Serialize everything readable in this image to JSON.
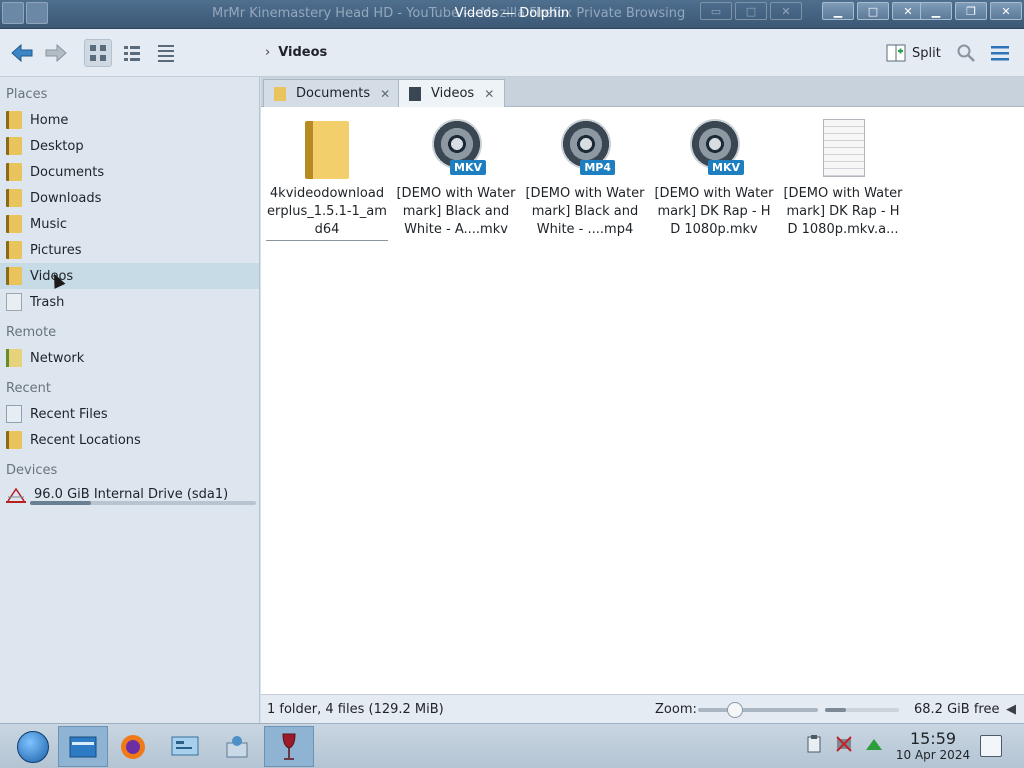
{
  "window": {
    "title": "Videos — Dolphin",
    "background_window_title": "MrMr Kinemastery Head HD - YouTube — Mozilla Firefox Private Browsing"
  },
  "toolbar": {
    "breadcrumb_current": "Videos",
    "split_label": "Split"
  },
  "sidebar": {
    "sections": {
      "places": "Places",
      "remote": "Remote",
      "recent": "Recent",
      "devices": "Devices"
    },
    "places": [
      {
        "label": "Home"
      },
      {
        "label": "Desktop"
      },
      {
        "label": "Documents"
      },
      {
        "label": "Downloads"
      },
      {
        "label": "Music"
      },
      {
        "label": "Pictures"
      },
      {
        "label": "Videos",
        "selected": true
      },
      {
        "label": "Trash"
      }
    ],
    "remote": [
      {
        "label": "Network"
      }
    ],
    "recent": [
      {
        "label": "Recent Files"
      },
      {
        "label": "Recent Locations"
      }
    ],
    "devices": [
      {
        "label": "96.0 GiB Internal Drive (sda1)",
        "usage_fraction": 0.27
      }
    ]
  },
  "tabs": [
    {
      "label": "Documents",
      "active": false
    },
    {
      "label": "Videos",
      "active": true
    }
  ],
  "files": [
    {
      "name": "4kvideodownloaderplus_1.5.1-1_amd64",
      "type": "folder"
    },
    {
      "name": "[DEMO with Watermark] Black and White - A....mkv",
      "type": "video",
      "badge": "MKV"
    },
    {
      "name": "[DEMO with Watermark] Black and White - ....mp4",
      "type": "video",
      "badge": "MP4"
    },
    {
      "name": "[DEMO with Watermark] DK Rap - HD 1080p.mkv",
      "type": "video",
      "badge": "MKV"
    },
    {
      "name": "[DEMO with Watermark] DK Rap - HD 1080p.mkv.a...",
      "type": "document"
    }
  ],
  "statusbar": {
    "info": "1 folder, 4 files (129.2 MiB)",
    "zoom_label": "Zoom:",
    "zoom_level_fraction": 0.28,
    "free_space": "68.2 GiB free",
    "disk_used_fraction": 0.29
  },
  "taskbar": {
    "time": "15:59",
    "date": "10 Apr 2024"
  },
  "colors": {
    "accent": "#1e7fc0",
    "selection": "#c7dbe7",
    "titlebar": "#3b5875"
  }
}
